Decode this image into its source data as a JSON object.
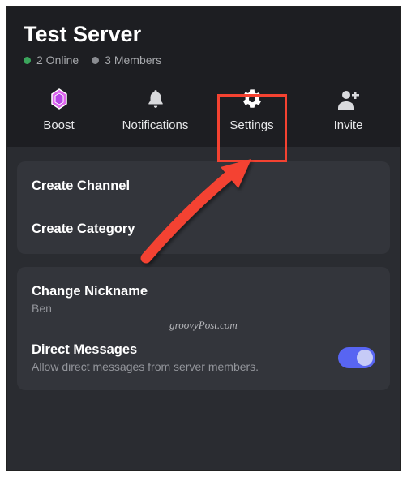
{
  "header": {
    "server_title": "Test Server",
    "online_text": "2 Online",
    "members_text": "3 Members"
  },
  "actions": {
    "boost": "Boost",
    "notifications": "Notifications",
    "settings": "Settings",
    "invite": "Invite"
  },
  "options": {
    "create_channel": "Create Channel",
    "create_category": "Create Category",
    "change_nickname": "Change Nickname",
    "nickname_value": "Ben",
    "direct_messages": "Direct Messages",
    "direct_messages_desc": "Allow direct messages from server members."
  },
  "watermark": "groovyPost.com",
  "colors": {
    "highlight": "#f44231",
    "toggle_on": "#5865f2"
  }
}
